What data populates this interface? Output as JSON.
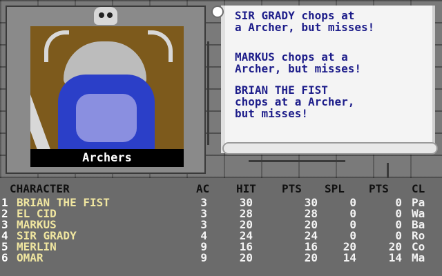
{
  "portrait": {
    "label": "Archers",
    "icons": [
      "skull-icon",
      "horned-helmet-warrior"
    ]
  },
  "messages": [
    "SIR GRADY chops at\na Archer, but misses!",
    "MARKUS chops at a\nArcher, but misses!",
    "BRIAN THE FIST\nchops at a Archer,\nbut misses!"
  ],
  "party": {
    "headers": {
      "character": "CHARACTER",
      "ac": "AC",
      "hit": "HIT",
      "pts": "PTS",
      "spl": "SPL",
      "pts2": "PTS",
      "cl": "CL"
    },
    "members": [
      {
        "num": "1",
        "name": "BRIAN THE FIST",
        "ac": "3",
        "hit": "30",
        "pts": "30",
        "spl": "0",
        "pts2": "0",
        "cl": "Pa"
      },
      {
        "num": "2",
        "name": "EL CID",
        "ac": "3",
        "hit": "28",
        "pts": "28",
        "spl": "0",
        "pts2": "0",
        "cl": "Wa"
      },
      {
        "num": "3",
        "name": "MARKUS",
        "ac": "3",
        "hit": "20",
        "pts": "20",
        "spl": "0",
        "pts2": "0",
        "cl": "Ba"
      },
      {
        "num": "4",
        "name": "SIR GRADY",
        "ac": "4",
        "hit": "24",
        "pts": "24",
        "spl": "0",
        "pts2": "0",
        "cl": "Ro"
      },
      {
        "num": "5",
        "name": "MERLIN",
        "ac": "9",
        "hit": "16",
        "pts": "16",
        "spl": "20",
        "pts2": "20",
        "cl": "Co"
      },
      {
        "num": "6",
        "name": "OMAR",
        "ac": "9",
        "hit": "20",
        "pts": "20",
        "spl": "14",
        "pts2": "14",
        "cl": "Ma"
      }
    ]
  }
}
